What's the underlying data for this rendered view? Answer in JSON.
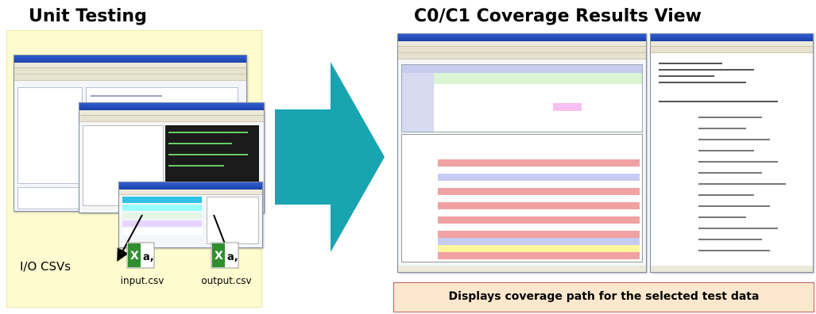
{
  "left": {
    "title": "Unit Testing",
    "io_label": "I/O CSVs",
    "files": [
      {
        "name": "input.csv",
        "icon": "excel-csv-icon"
      },
      {
        "name": "output.csv",
        "icon": "excel-csv-icon"
      }
    ]
  },
  "right": {
    "title": "C0/C1 Coverage Results View",
    "caption": "Displays coverage path for the selected test data"
  },
  "colors": {
    "panel_bg": "#fffbd0",
    "arrow": "#18a4b1",
    "caption_bg": "#fde8cd",
    "caption_border": "#c45a5a",
    "covered_red": "#f0a1a1",
    "covered_blue": "#c6ccf5",
    "covered_yellow": "#fff59a"
  }
}
